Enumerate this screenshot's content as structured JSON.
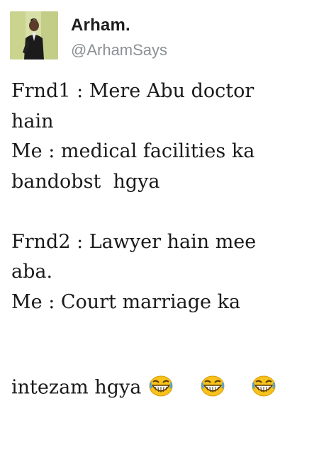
{
  "author": {
    "name": "Arham.",
    "handle": "@ArhamSays",
    "avatar_icon": "profile-photo"
  },
  "tweet": {
    "lines": [
      "Frnd1 : Mere Abu doctor",
      "hain",
      "Me : medical facilities ka",
      "bandobst  hgya",
      "",
      "Frnd2 : Lawyer hain mee",
      "aba.",
      "Me : Court marriage ka",
      "intezam hgya"
    ],
    "emojis": [
      "laughing-face-icon",
      "laughing-face-icon",
      "laughing-face-icon"
    ]
  },
  "colors": {
    "name": "#1c1c1c",
    "handle": "#8a9094",
    "text": "#1a1a1a",
    "emoji": "#f7c21b"
  }
}
